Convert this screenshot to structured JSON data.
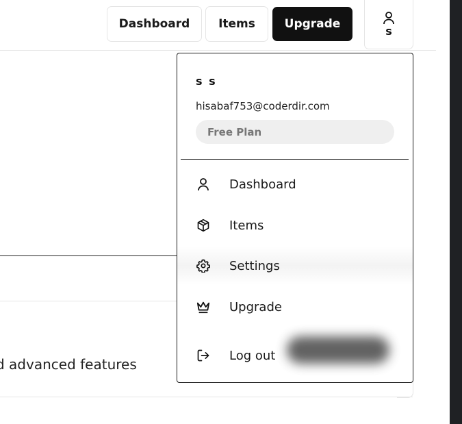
{
  "nav": {
    "dashboard_label": "Dashboard",
    "items_label": "Items",
    "upgrade_label": "Upgrade",
    "avatar_letter": "s"
  },
  "background": {
    "feature_text": "d advanced features"
  },
  "menu": {
    "user_name": "s s",
    "user_email": "hisabaf753@coderdir.com",
    "plan": "Free Plan",
    "items": [
      {
        "label": "Dashboard",
        "icon": "user-icon"
      },
      {
        "label": "Items",
        "icon": "box-icon"
      },
      {
        "label": "Settings",
        "icon": "gear-icon"
      },
      {
        "label": "Upgrade",
        "icon": "crown-icon"
      },
      {
        "label": "Log out",
        "icon": "logout-icon"
      }
    ]
  },
  "colors": {
    "accent_dark": "#111111",
    "border": "#e5e5e5",
    "badge_bg": "#efefef"
  }
}
